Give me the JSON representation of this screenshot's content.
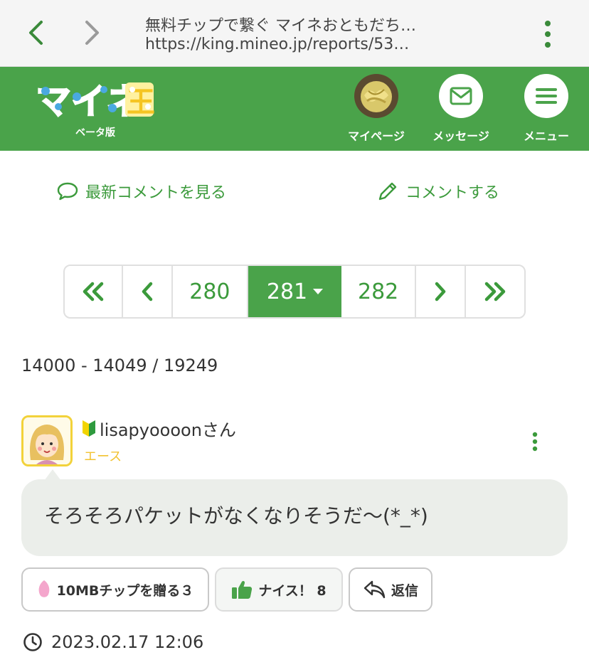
{
  "browser": {
    "title": "無料チップで繋ぐ マイネおともだち…",
    "url": "https://king.mineo.jp/reports/53…"
  },
  "header": {
    "logo_text": "マイネ王",
    "logo_sub": "ベータ版",
    "mypage_label": "マイページ",
    "message_label": "メッセージ",
    "menu_label": "メニュー"
  },
  "actions": {
    "latest_comments": "最新コメントを見る",
    "write_comment": "コメントする"
  },
  "pagination": {
    "prev_page": "280",
    "current_page": "281",
    "next_page": "282"
  },
  "range_text": "14000 - 14049 / 19249",
  "comment": {
    "user_name": "lisapyoooonさん",
    "rank": "エース",
    "text": "そろそろパケットがなくなりそうだ〜(*_*)",
    "chip_button": "10MBチップを贈る３",
    "nice_button": "ナイス！ 8",
    "reply_button": "返信",
    "timestamp": "2023.02.17 12:06"
  },
  "colors": {
    "brand_green": "#4aa34a",
    "link_green": "#3b9a3b",
    "rank_yellow": "#f2c230",
    "bubble_bg": "#ebeeea"
  }
}
